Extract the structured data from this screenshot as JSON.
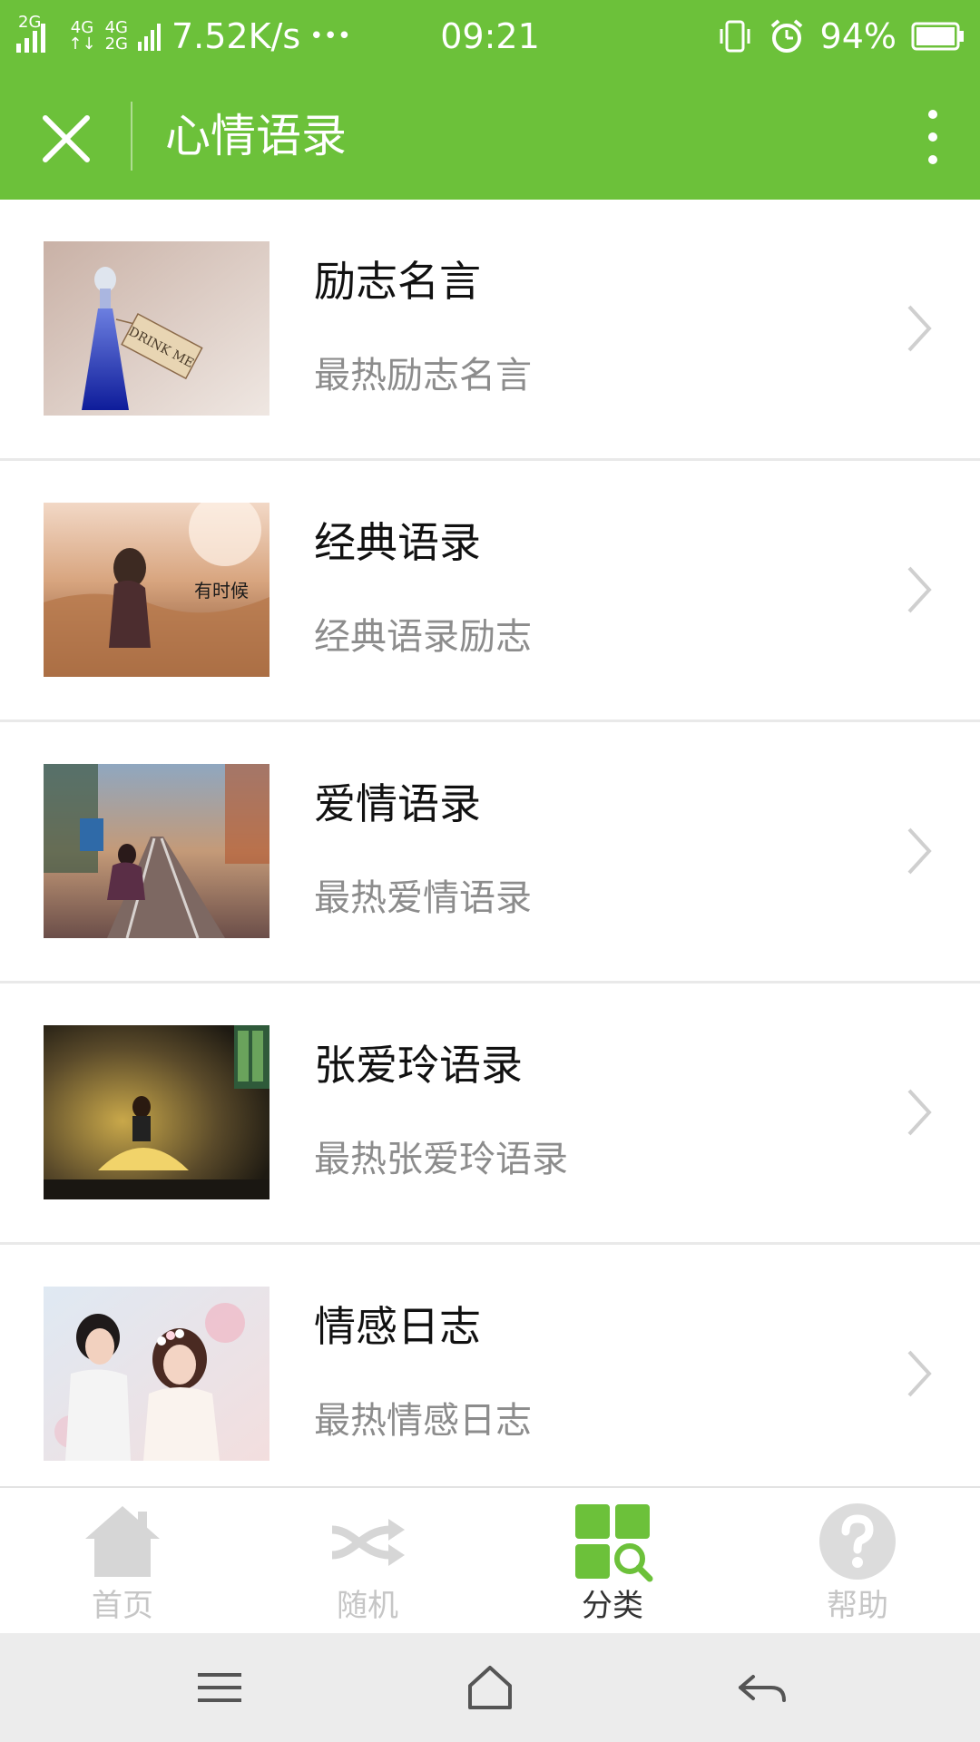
{
  "status_bar": {
    "net1": "2G",
    "net2a": "4G",
    "net2b": "4G",
    "net3": "2G",
    "speed": "7.52K/s",
    "dots": "•••",
    "time": "09:21",
    "battery": "94%"
  },
  "header": {
    "title": "心情语录"
  },
  "list": [
    {
      "title": "励志名言",
      "subtitle": "最热励志名言",
      "thumb_caption": "DRINK ME"
    },
    {
      "title": "经典语录",
      "subtitle": "经典语录励志",
      "thumb_caption": "有时候"
    },
    {
      "title": "爱情语录",
      "subtitle": "最热爱情语录",
      "thumb_caption": ""
    },
    {
      "title": "张爱玲语录",
      "subtitle": "最热张爱玲语录",
      "thumb_caption": ""
    },
    {
      "title": "情感日志",
      "subtitle": "最热情感日志",
      "thumb_caption": ""
    }
  ],
  "tabs": [
    {
      "label": "首页",
      "icon": "home-icon"
    },
    {
      "label": "随机",
      "icon": "shuffle-icon"
    },
    {
      "label": "分类",
      "icon": "category-search-icon"
    },
    {
      "label": "帮助",
      "icon": "help-icon"
    }
  ],
  "colors": {
    "brand_green": "#6cc13a",
    "inactive_icon": "#d6d6d6"
  }
}
